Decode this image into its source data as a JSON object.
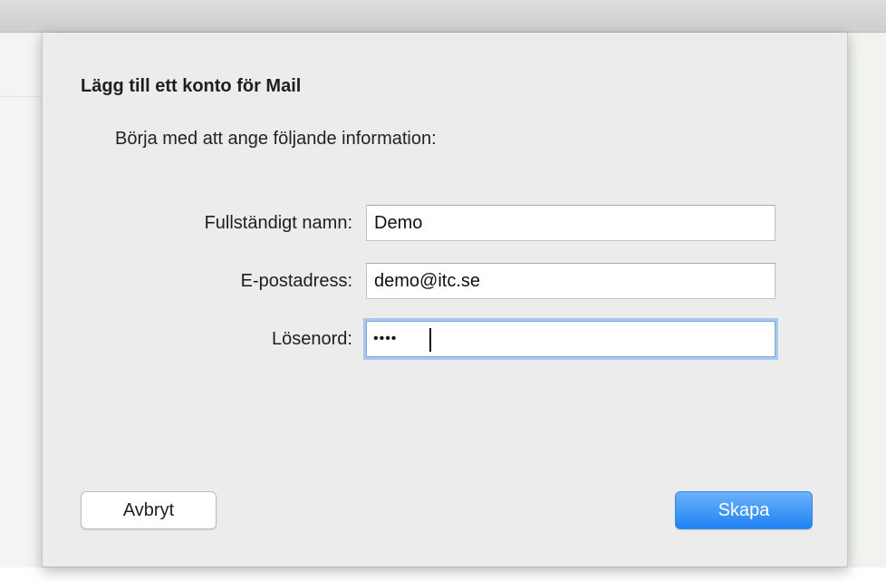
{
  "dialog": {
    "title": "Lägg till ett konto för Mail",
    "subtitle": "Börja med att ange följande information:"
  },
  "form": {
    "fields": [
      {
        "label": "Fullständigt namn:",
        "value": "Demo",
        "type": "text"
      },
      {
        "label": "E-postadress:",
        "value": "demo@itc.se",
        "type": "email"
      },
      {
        "label": "Lösenord:",
        "value": "••••",
        "type": "password",
        "focused": true
      }
    ]
  },
  "buttons": {
    "cancel_label": "Avbryt",
    "create_label": "Skapa"
  },
  "colors": {
    "accent": "#1d82f3",
    "focus_ring": "#a9c8ee",
    "sheet_background": "#ececec"
  }
}
